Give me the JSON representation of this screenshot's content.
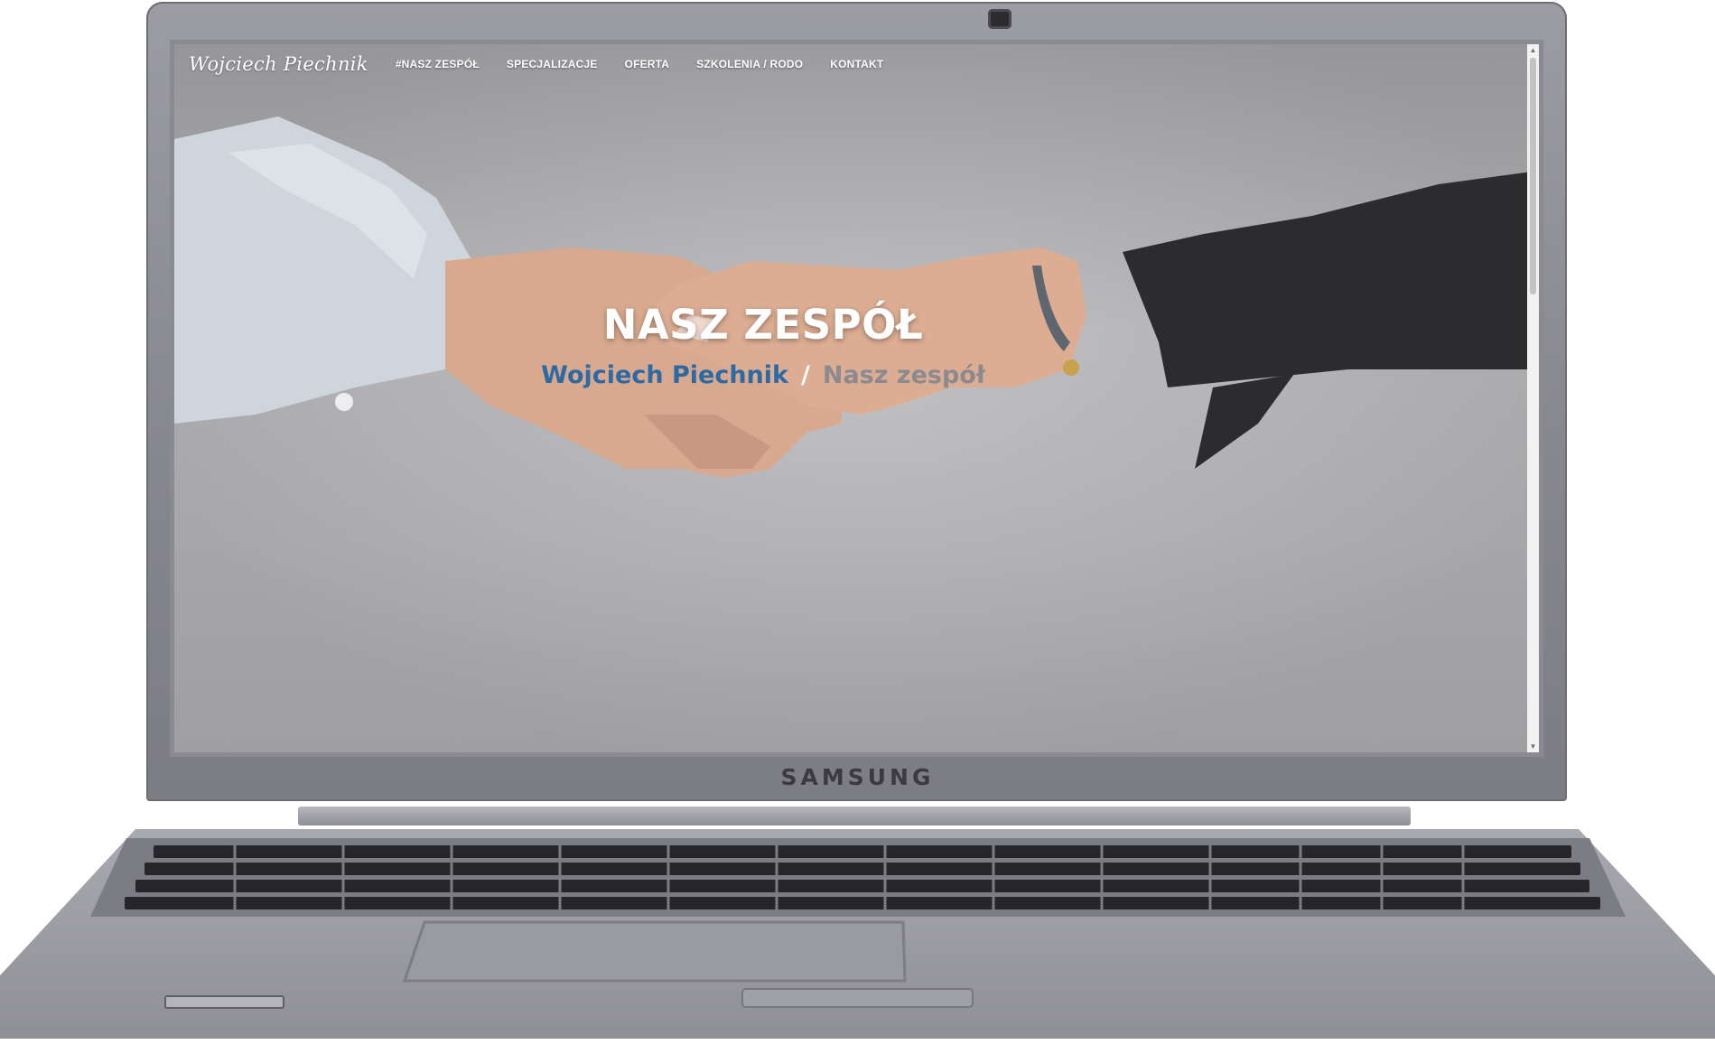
{
  "device": {
    "brand": "SAMSUNG"
  },
  "site": {
    "logo": "Wojciech Piechnik",
    "nav": [
      {
        "label": "#NASZ ZESPÓŁ"
      },
      {
        "label": "SPECJALIZACJE"
      },
      {
        "label": "OFERTA"
      },
      {
        "label": "SZKOLENIA / RODO"
      },
      {
        "label": "KONTAKT"
      }
    ],
    "hero": {
      "title": "NASZ ZESPÓŁ",
      "breadcrumb": {
        "home": "Wojciech Piechnik",
        "separator": "/",
        "current": "Nasz zespół"
      }
    }
  },
  "colors": {
    "breadcrumb_link": "#2d6aa3",
    "breadcrumb_current": "#8a8a8f",
    "hero_text": "#ffffff"
  },
  "icons": {
    "scroll_up": "scroll-up-arrow-icon",
    "scroll_down": "scroll-down-arrow-icon"
  }
}
